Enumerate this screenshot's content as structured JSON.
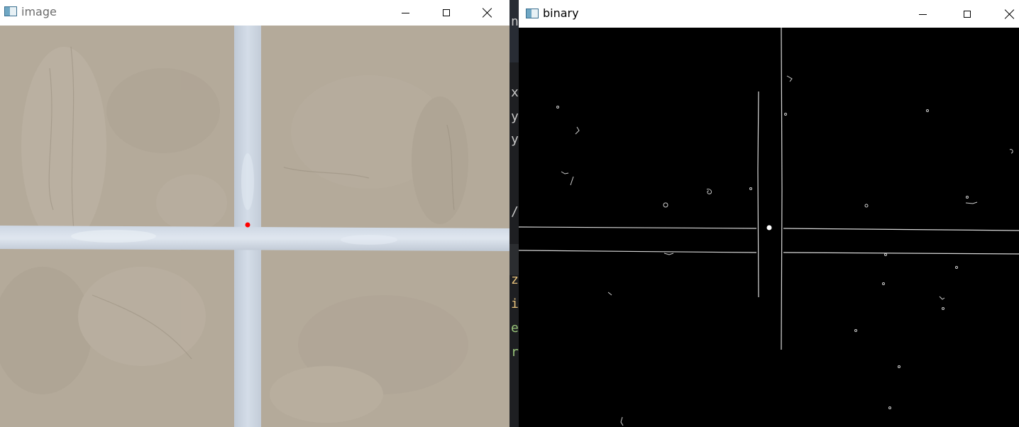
{
  "windows": {
    "image": {
      "title": "image",
      "controls": [
        "minimize",
        "maximize",
        "close"
      ],
      "marker_color": "#ff0000"
    },
    "binary": {
      "title": "binary",
      "controls": [
        "minimize",
        "maximize",
        "close"
      ],
      "marker_color": "#ffffff"
    }
  },
  "editor_fragments": [
    {
      "text": "na",
      "color": "#c8c8c8"
    },
    {
      "text": "x",
      "color": "#c8c8c8"
    },
    {
      "text": "y",
      "color": "#c8c8c8"
    },
    {
      "text": "y",
      "color": "#c8c8c8"
    },
    {
      "text": "/,",
      "color": "#c8c8c8"
    },
    {
      "text": "ze",
      "color": "#e5c07b"
    },
    {
      "text": "iz",
      "color": "#e5c07b"
    },
    {
      "text": "e'",
      "color": "#98c379"
    },
    {
      "text": "ry",
      "color": "#98c379"
    }
  ],
  "colors": {
    "concrete": "#b4aa9a",
    "tape": "#c9d3df",
    "binary_background": "#000000",
    "edge": "#d8d8d8"
  }
}
